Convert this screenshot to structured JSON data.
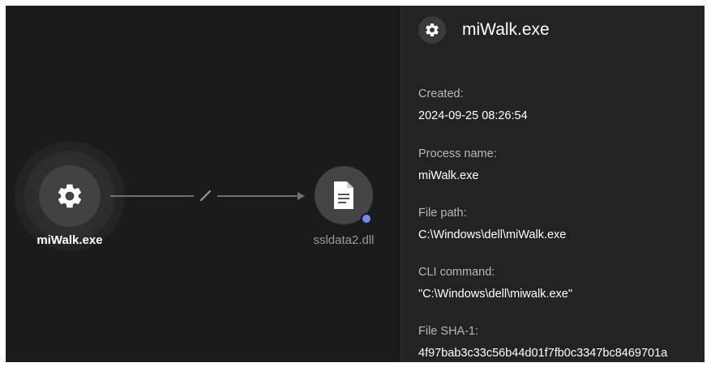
{
  "graph": {
    "source_node": {
      "label": "miWalk.exe",
      "icon": "gear-icon"
    },
    "target_node": {
      "label": "ssldata2.dll",
      "icon": "document-icon",
      "indicator_color": "#6b8cff"
    },
    "edge": {
      "icon": "pencil-icon"
    }
  },
  "details": {
    "title": "miWalk.exe",
    "icon": "gear-icon",
    "fields": [
      {
        "label": "Created:",
        "value": "2024-09-25 08:26:54"
      },
      {
        "label": "Process name:",
        "value": "miWalk.exe"
      },
      {
        "label": "File path:",
        "value": "C:\\Windows\\dell\\miWalk.exe"
      },
      {
        "label": "CLI command:",
        "value": "\"C:\\Windows\\dell\\miwalk.exe\""
      },
      {
        "label": "File SHA-1:",
        "value": "4f97bab3c33c56b44d01f7fb0c3347bc8469701a"
      }
    ]
  }
}
